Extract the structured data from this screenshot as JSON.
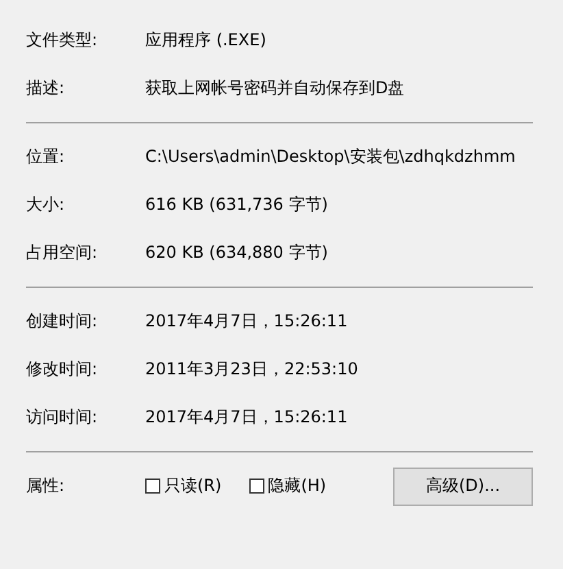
{
  "groups": [
    {
      "rows": [
        {
          "label": "文件类型:",
          "value": "应用程序 (.EXE)"
        },
        {
          "label": "描述:",
          "value": "获取上网帐号密码并自动保存到D盘"
        }
      ]
    },
    {
      "rows": [
        {
          "label": "位置:",
          "value": "C:\\Users\\admin\\Desktop\\安装包\\zdhqkdzhmm"
        },
        {
          "label": "大小:",
          "value": "616 KB (631,736 字节)"
        },
        {
          "label": "占用空间:",
          "value": "620 KB (634,880 字节)"
        }
      ]
    },
    {
      "rows": [
        {
          "label": "创建时间:",
          "value": "2017年4月7日，15:26:11"
        },
        {
          "label": "修改时间:",
          "value": "2011年3月23日，22:53:10"
        },
        {
          "label": "访问时间:",
          "value": "2017年4月7日，15:26:11"
        }
      ]
    }
  ],
  "attributes": {
    "label": "属性:",
    "checkboxes": [
      {
        "label": "只读(R)",
        "checked": false
      },
      {
        "label": "隐藏(H)",
        "checked": false
      }
    ],
    "button": "高级(D)..."
  }
}
